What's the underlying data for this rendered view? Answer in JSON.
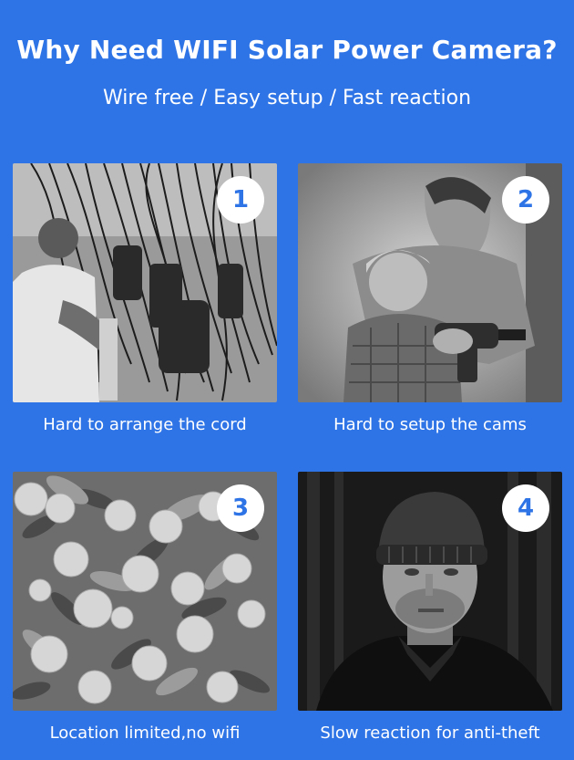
{
  "header": {
    "title": "Why Need WIFI Solar Power Camera?",
    "subtitle": "Wire free / Easy setup / Fast reaction"
  },
  "cards": [
    {
      "number": "1",
      "caption": "Hard to arrange the cord"
    },
    {
      "number": "2",
      "caption": "Hard to setup the cams"
    },
    {
      "number": "3",
      "caption": "Location limited,no wifi"
    },
    {
      "number": "4",
      "caption": "Slow reaction for anti-theft"
    }
  ],
  "colors": {
    "background": "#2f74e6",
    "badge_text": "#2f74e6",
    "badge_fill": "#ffffff"
  }
}
